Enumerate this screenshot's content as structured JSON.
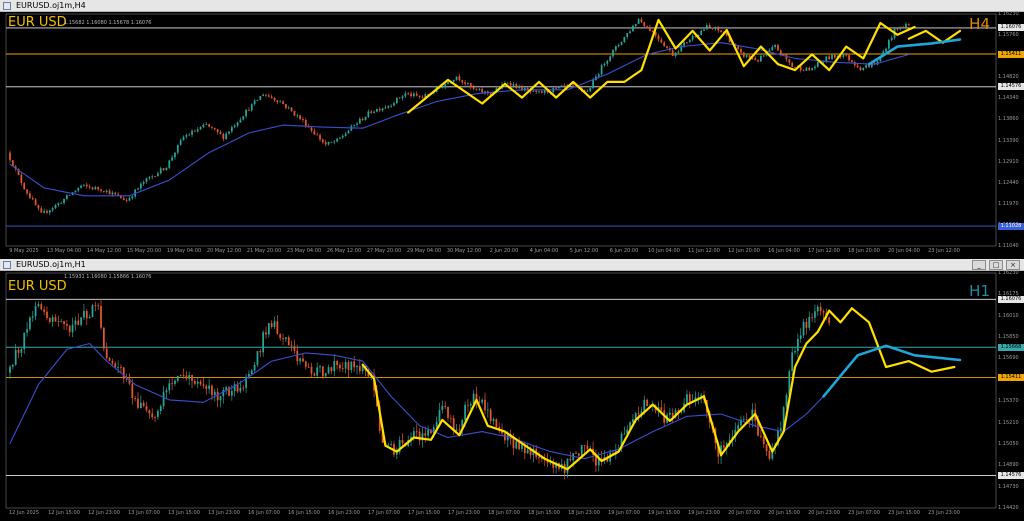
{
  "colors": {
    "background": "#000000",
    "bull": "#26a69a",
    "bear": "#e4562a",
    "ma": "#3a4fd0",
    "zigzag": "#ffe000",
    "projection_ma": "#1fa6d8",
    "level_white": "#e6e6e6",
    "level_orange": "#f0a500",
    "level_teal": "#3aa8a8",
    "level_blue": "#3a60d8"
  },
  "top_window": {
    "title": "EURUSD.oj1m,H4",
    "symbol": "EUR USD",
    "ohlc": "1.15682 1.16080 1.15678 1.16076",
    "timeframe": "H4",
    "icons": [],
    "price_labels": [
      "1.16230",
      "1.15760",
      "1.15290",
      "1.14820",
      "1.14340",
      "1.13860",
      "1.13390",
      "1.12910",
      "1.12440",
      "1.11970",
      "1.11500",
      "1.11040"
    ],
    "level_labels": [
      "1.16076",
      "1.15411",
      "1.14576",
      "1.11028"
    ],
    "time_labels": [
      "9 May 2025",
      "13 May 04:00",
      "14 May 12:00",
      "15 May 20:00",
      "19 May 04:00",
      "20 May 12:00",
      "21 May 20:00",
      "23 May 04:00",
      "26 May 12:00",
      "27 May 20:00",
      "29 May 04:00",
      "30 May 12:00",
      "2 Jun 20:00",
      "4 Jun 04:00",
      "5 Jun 12:00",
      "6 Jun 20:00",
      "10 Jun 04:00",
      "11 Jun 12:00",
      "12 Jun 20:00",
      "16 Jun 04:00",
      "17 Jun 12:00",
      "18 Jun 20:00",
      "20 Jun 04:00",
      "23 Jun 12:00"
    ]
  },
  "bottom_window": {
    "title": "EURUSD.oj1m,H1",
    "symbol": "EUR USD",
    "ohlc": "1.15931 1.16080 1.15866 1.16076",
    "timeframe": "H1",
    "window_buttons": [
      "_",
      "□",
      "×"
    ],
    "price_labels": [
      "1.16230",
      "1.16175",
      "1.16010",
      "1.15850",
      "1.15690",
      "1.15530",
      "1.15370",
      "1.15210",
      "1.15050",
      "1.14890",
      "1.14730",
      "1.14420"
    ],
    "level_labels": [
      "1.16076",
      "1.15668",
      "1.15411",
      "1.14576"
    ],
    "time_labels": [
      "12 Jun 2025",
      "12 Jun 15:00",
      "12 Jun 23:00",
      "13 Jun 07:00",
      "13 Jun 15:00",
      "13 Jun 23:00",
      "16 Jun 07:00",
      "16 Jun 15:00",
      "16 Jun 23:00",
      "17 Jun 07:00",
      "17 Jun 15:00",
      "17 Jun 23:00",
      "18 Jun 07:00",
      "18 Jun 15:00",
      "18 Jun 23:00",
      "19 Jun 07:00",
      "19 Jun 15:00",
      "19 Jun 23:00",
      "20 Jun 07:00",
      "20 Jun 15:00",
      "20 Jun 23:00",
      "23 Jun 07:00",
      "23 Jun 15:00",
      "23 Jun 23:00"
    ]
  },
  "chart_data": [
    {
      "type": "candlestick",
      "title": "EURUSD.oj1m,H4",
      "ylim": [
        1.1052,
        1.1643
      ],
      "x_range": [
        "9 May 2025",
        "23 Jun 12:00"
      ],
      "key_levels": [
        {
          "value": 1.16076,
          "color": "#e6e6e6"
        },
        {
          "value": 1.15411,
          "color": "#f0a500"
        },
        {
          "value": 1.14576,
          "color": "#e6e6e6"
        },
        {
          "value": 1.11028,
          "color": "#3a60d8"
        }
      ],
      "price_anchors": [
        [
          0,
          1.129
        ],
        [
          6,
          1.12
        ],
        [
          12,
          1.1132
        ],
        [
          18,
          1.116
        ],
        [
          26,
          1.1205
        ],
        [
          34,
          1.1195
        ],
        [
          42,
          1.1168
        ],
        [
          48,
          1.1215
        ],
        [
          56,
          1.1255
        ],
        [
          62,
          1.133
        ],
        [
          70,
          1.136
        ],
        [
          76,
          1.133
        ],
        [
          84,
          1.1395
        ],
        [
          90,
          1.144
        ],
        [
          96,
          1.142
        ],
        [
          104,
          1.137
        ],
        [
          112,
          1.131
        ],
        [
          116,
          1.132
        ],
        [
          122,
          1.136
        ],
        [
          128,
          1.1395
        ],
        [
          134,
          1.141
        ],
        [
          140,
          1.144
        ],
        [
          146,
          1.143
        ],
        [
          152,
          1.1455
        ],
        [
          158,
          1.1485
        ],
        [
          164,
          1.145
        ],
        [
          170,
          1.144
        ],
        [
          176,
          1.147
        ],
        [
          180,
          1.1455
        ],
        [
          186,
          1.144
        ],
        [
          192,
          1.145
        ],
        [
          198,
          1.146
        ],
        [
          204,
          1.1445
        ],
        [
          210,
          1.152
        ],
        [
          216,
          1.1575
        ],
        [
          222,
          1.163
        ],
        [
          228,
          1.159
        ],
        [
          234,
          1.154
        ],
        [
          240,
          1.158
        ],
        [
          246,
          1.161
        ],
        [
          252,
          1.1595
        ],
        [
          258,
          1.154
        ],
        [
          264,
          1.1525
        ],
        [
          270,
          1.156
        ],
        [
          276,
          1.151
        ],
        [
          282,
          1.15
        ],
        [
          288,
          1.153
        ],
        [
          294,
          1.154
        ],
        [
          300,
          1.1505
        ],
        [
          306,
          1.152
        ],
        [
          312,
          1.16
        ],
        [
          316,
          1.1616
        ]
      ],
      "moving_average_anchors": [
        [
          0,
          1.126
        ],
        [
          12,
          1.12
        ],
        [
          26,
          1.118
        ],
        [
          42,
          1.118
        ],
        [
          56,
          1.122
        ],
        [
          70,
          1.129
        ],
        [
          84,
          1.134
        ],
        [
          96,
          1.136
        ],
        [
          110,
          1.1355
        ],
        [
          124,
          1.1352
        ],
        [
          136,
          1.1385
        ],
        [
          150,
          1.142
        ],
        [
          164,
          1.144
        ],
        [
          180,
          1.145
        ],
        [
          196,
          1.145
        ],
        [
          210,
          1.149
        ],
        [
          224,
          1.154
        ],
        [
          236,
          1.156
        ],
        [
          250,
          1.157
        ],
        [
          262,
          1.1555
        ],
        [
          276,
          1.153
        ],
        [
          290,
          1.152
        ],
        [
          304,
          1.1515
        ],
        [
          316,
          1.154
        ]
      ],
      "zigzag": [
        [
          140,
          1.1392
        ],
        [
          154,
          1.1475
        ],
        [
          166,
          1.1415
        ],
        [
          174,
          1.1465
        ],
        [
          180,
          1.143
        ],
        [
          186,
          1.147
        ],
        [
          192,
          1.143
        ],
        [
          198,
          1.147
        ],
        [
          204,
          1.143
        ],
        [
          210,
          1.147
        ],
        [
          216,
          1.147
        ],
        [
          222,
          1.15
        ],
        [
          228,
          1.1628
        ],
        [
          234,
          1.1555
        ],
        [
          240,
          1.16
        ],
        [
          246,
          1.155
        ],
        [
          252,
          1.1602
        ],
        [
          258,
          1.151
        ],
        [
          264,
          1.156
        ],
        [
          270,
          1.1515
        ],
        [
          276,
          1.15
        ],
        [
          282,
          1.154
        ],
        [
          288,
          1.15
        ],
        [
          294,
          1.156
        ],
        [
          300,
          1.153
        ],
        [
          306,
          1.162
        ],
        [
          312,
          1.159
        ],
        [
          318,
          1.161
        ]
      ],
      "projection_zigzag": [
        [
          316,
          1.158
        ],
        [
          322,
          1.16
        ],
        [
          328,
          1.157
        ],
        [
          334,
          1.16
        ]
      ],
      "projection_ma": [
        [
          302,
          1.1515
        ],
        [
          312,
          1.156
        ],
        [
          324,
          1.1568
        ],
        [
          334,
          1.1578
        ]
      ]
    },
    {
      "type": "candlestick",
      "title": "EURUSD.oj1m,H1",
      "ylim": [
        1.143,
        1.163
      ],
      "x_range": [
        "12 Jun 2025",
        "23 Jun 23:00"
      ],
      "key_levels": [
        {
          "value": 1.16076,
          "color": "#e6e6e6"
        },
        {
          "value": 1.15668,
          "color": "#3aa8a8"
        },
        {
          "value": 1.15411,
          "color": "#f0a500"
        },
        {
          "value": 1.14576,
          "color": "#e6e6e6"
        }
      ],
      "price_anchors": [
        [
          0,
          1.1545
        ],
        [
          6,
          1.1575
        ],
        [
          10,
          1.1605
        ],
        [
          16,
          1.159
        ],
        [
          22,
          1.158
        ],
        [
          28,
          1.1595
        ],
        [
          32,
          1.16
        ],
        [
          34,
          1.1565
        ],
        [
          40,
          1.1545
        ],
        [
          46,
          1.152
        ],
        [
          52,
          1.1505
        ],
        [
          56,
          1.153
        ],
        [
          62,
          1.1545
        ],
        [
          68,
          1.1535
        ],
        [
          74,
          1.1525
        ],
        [
          80,
          1.153
        ],
        [
          86,
          1.1545
        ],
        [
          92,
          1.159
        ],
        [
          98,
          1.1575
        ],
        [
          104,
          1.155
        ],
        [
          110,
          1.1545
        ],
        [
          116,
          1.1555
        ],
        [
          122,
          1.155
        ],
        [
          128,
          1.1545
        ],
        [
          132,
          1.1485
        ],
        [
          136,
          1.148
        ],
        [
          142,
          1.149
        ],
        [
          148,
          1.1495
        ],
        [
          154,
          1.1515
        ],
        [
          158,
          1.1495
        ],
        [
          162,
          1.152
        ],
        [
          166,
          1.1525
        ],
        [
          172,
          1.15
        ],
        [
          178,
          1.1485
        ],
        [
          184,
          1.148
        ],
        [
          190,
          1.147
        ],
        [
          196,
          1.1465
        ],
        [
          202,
          1.148
        ],
        [
          208,
          1.147
        ],
        [
          214,
          1.148
        ],
        [
          220,
          1.151
        ],
        [
          226,
          1.152
        ],
        [
          232,
          1.1505
        ],
        [
          238,
          1.152
        ],
        [
          244,
          1.153
        ],
        [
          250,
          1.1475
        ],
        [
          256,
          1.1495
        ],
        [
          262,
          1.151
        ],
        [
          268,
          1.147
        ],
        [
          272,
          1.15
        ],
        [
          276,
          1.156
        ],
        [
          280,
          1.1585
        ],
        [
          284,
          1.16
        ],
        [
          288,
          1.159
        ]
      ],
      "moving_average_anchors": [
        [
          0,
          1.1485
        ],
        [
          10,
          1.1535
        ],
        [
          20,
          1.1565
        ],
        [
          28,
          1.157
        ],
        [
          34,
          1.1555
        ],
        [
          44,
          1.1535
        ],
        [
          56,
          1.1522
        ],
        [
          68,
          1.152
        ],
        [
          80,
          1.1535
        ],
        [
          92,
          1.1555
        ],
        [
          104,
          1.1562
        ],
        [
          114,
          1.156
        ],
        [
          124,
          1.1555
        ],
        [
          134,
          1.1525
        ],
        [
          144,
          1.15
        ],
        [
          154,
          1.149
        ],
        [
          166,
          1.1495
        ],
        [
          176,
          1.149
        ],
        [
          190,
          1.1478
        ],
        [
          202,
          1.1472
        ],
        [
          214,
          1.148
        ],
        [
          226,
          1.1495
        ],
        [
          238,
          1.1508
        ],
        [
          250,
          1.151
        ],
        [
          262,
          1.15
        ],
        [
          272,
          1.1495
        ],
        [
          280,
          1.151
        ],
        [
          288,
          1.153
        ]
      ],
      "zigzag": [
        [
          124,
          1.1552
        ],
        [
          128,
          1.154
        ],
        [
          132,
          1.1483
        ],
        [
          136,
          1.1478
        ],
        [
          142,
          1.149
        ],
        [
          148,
          1.1488
        ],
        [
          152,
          1.1505
        ],
        [
          158,
          1.1492
        ],
        [
          164,
          1.1522
        ],
        [
          168,
          1.15
        ],
        [
          174,
          1.1495
        ],
        [
          180,
          1.1485
        ],
        [
          188,
          1.1472
        ],
        [
          196,
          1.1463
        ],
        [
          204,
          1.148
        ],
        [
          208,
          1.147
        ],
        [
          214,
          1.1478
        ],
        [
          220,
          1.1505
        ],
        [
          226,
          1.1518
        ],
        [
          232,
          1.1504
        ],
        [
          238,
          1.1518
        ],
        [
          244,
          1.1525
        ],
        [
          250,
          1.1475
        ],
        [
          256,
          1.1495
        ],
        [
          262,
          1.151
        ],
        [
          268,
          1.1478
        ],
        [
          272,
          1.1495
        ],
        [
          276,
          1.155
        ],
        [
          280,
          1.157
        ],
        [
          284,
          1.158
        ],
        [
          288,
          1.1598
        ],
        [
          292,
          1.1588
        ],
        [
          296,
          1.16
        ]
      ],
      "projection_zigzag": [
        [
          296,
          1.16
        ],
        [
          302,
          1.1588
        ],
        [
          308,
          1.155
        ],
        [
          316,
          1.1555
        ],
        [
          324,
          1.1546
        ],
        [
          332,
          1.155
        ]
      ],
      "projection_ma": [
        [
          286,
          1.1525
        ],
        [
          298,
          1.156
        ],
        [
          308,
          1.1568
        ],
        [
          318,
          1.156
        ],
        [
          334,
          1.1556
        ]
      ]
    }
  ]
}
